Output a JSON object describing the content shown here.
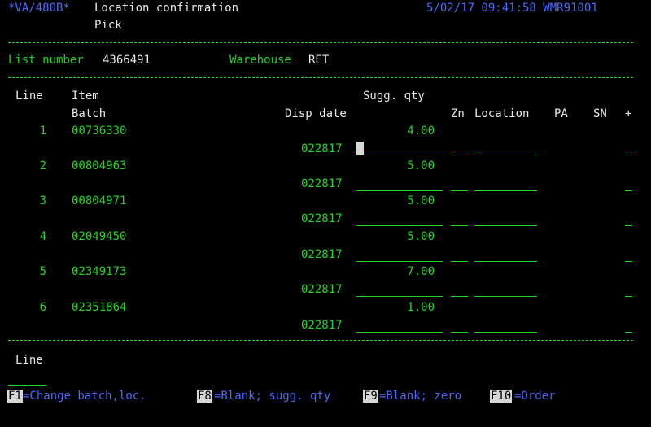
{
  "header": {
    "program": "*VA/480B*",
    "title": "Location confirmation",
    "subtitle": "Pick",
    "datetime": "5/02/17 09:41:58 WMR91001"
  },
  "list": {
    "number_label": "List number",
    "number": "4366491",
    "warehouse_label": "Warehouse",
    "warehouse": "RET"
  },
  "columns": {
    "line": "Line",
    "item": "Item",
    "batch": "Batch",
    "sugg_qty": "Sugg. qty",
    "disp_date": "Disp date",
    "zn": "Zn",
    "location": "Location",
    "pa": "PA",
    "sn": "SN",
    "plus": "+"
  },
  "rows": [
    {
      "line": "1",
      "item": "00736330",
      "qty": "4.00",
      "disp_date": "022817"
    },
    {
      "line": "2",
      "item": "00804963",
      "qty": "5.00",
      "disp_date": "022817"
    },
    {
      "line": "3",
      "item": "00804971",
      "qty": "5.00",
      "disp_date": "022817"
    },
    {
      "line": "4",
      "item": "02049450",
      "qty": "5.00",
      "disp_date": "022817"
    },
    {
      "line": "5",
      "item": "02349173",
      "qty": "7.00",
      "disp_date": "022817"
    },
    {
      "line": "6",
      "item": "02351864",
      "qty": "1.00",
      "disp_date": "022817"
    }
  ],
  "footer": {
    "line_label": "Line",
    "f1": {
      "key": "F1",
      "text": "=Change batch,loc."
    },
    "f8": {
      "key": "F8",
      "text": "=Blank; sugg. qty"
    },
    "f9": {
      "key": "F9",
      "text": "=Blank; zero"
    },
    "f10": {
      "key": "F10",
      "text": "=Order"
    }
  },
  "colors": {
    "background": "#000000",
    "field_text": "#23d623",
    "label_text": "#e8e8e8",
    "info_text": "#4a6bff",
    "cursor": "#d8d8d8"
  }
}
